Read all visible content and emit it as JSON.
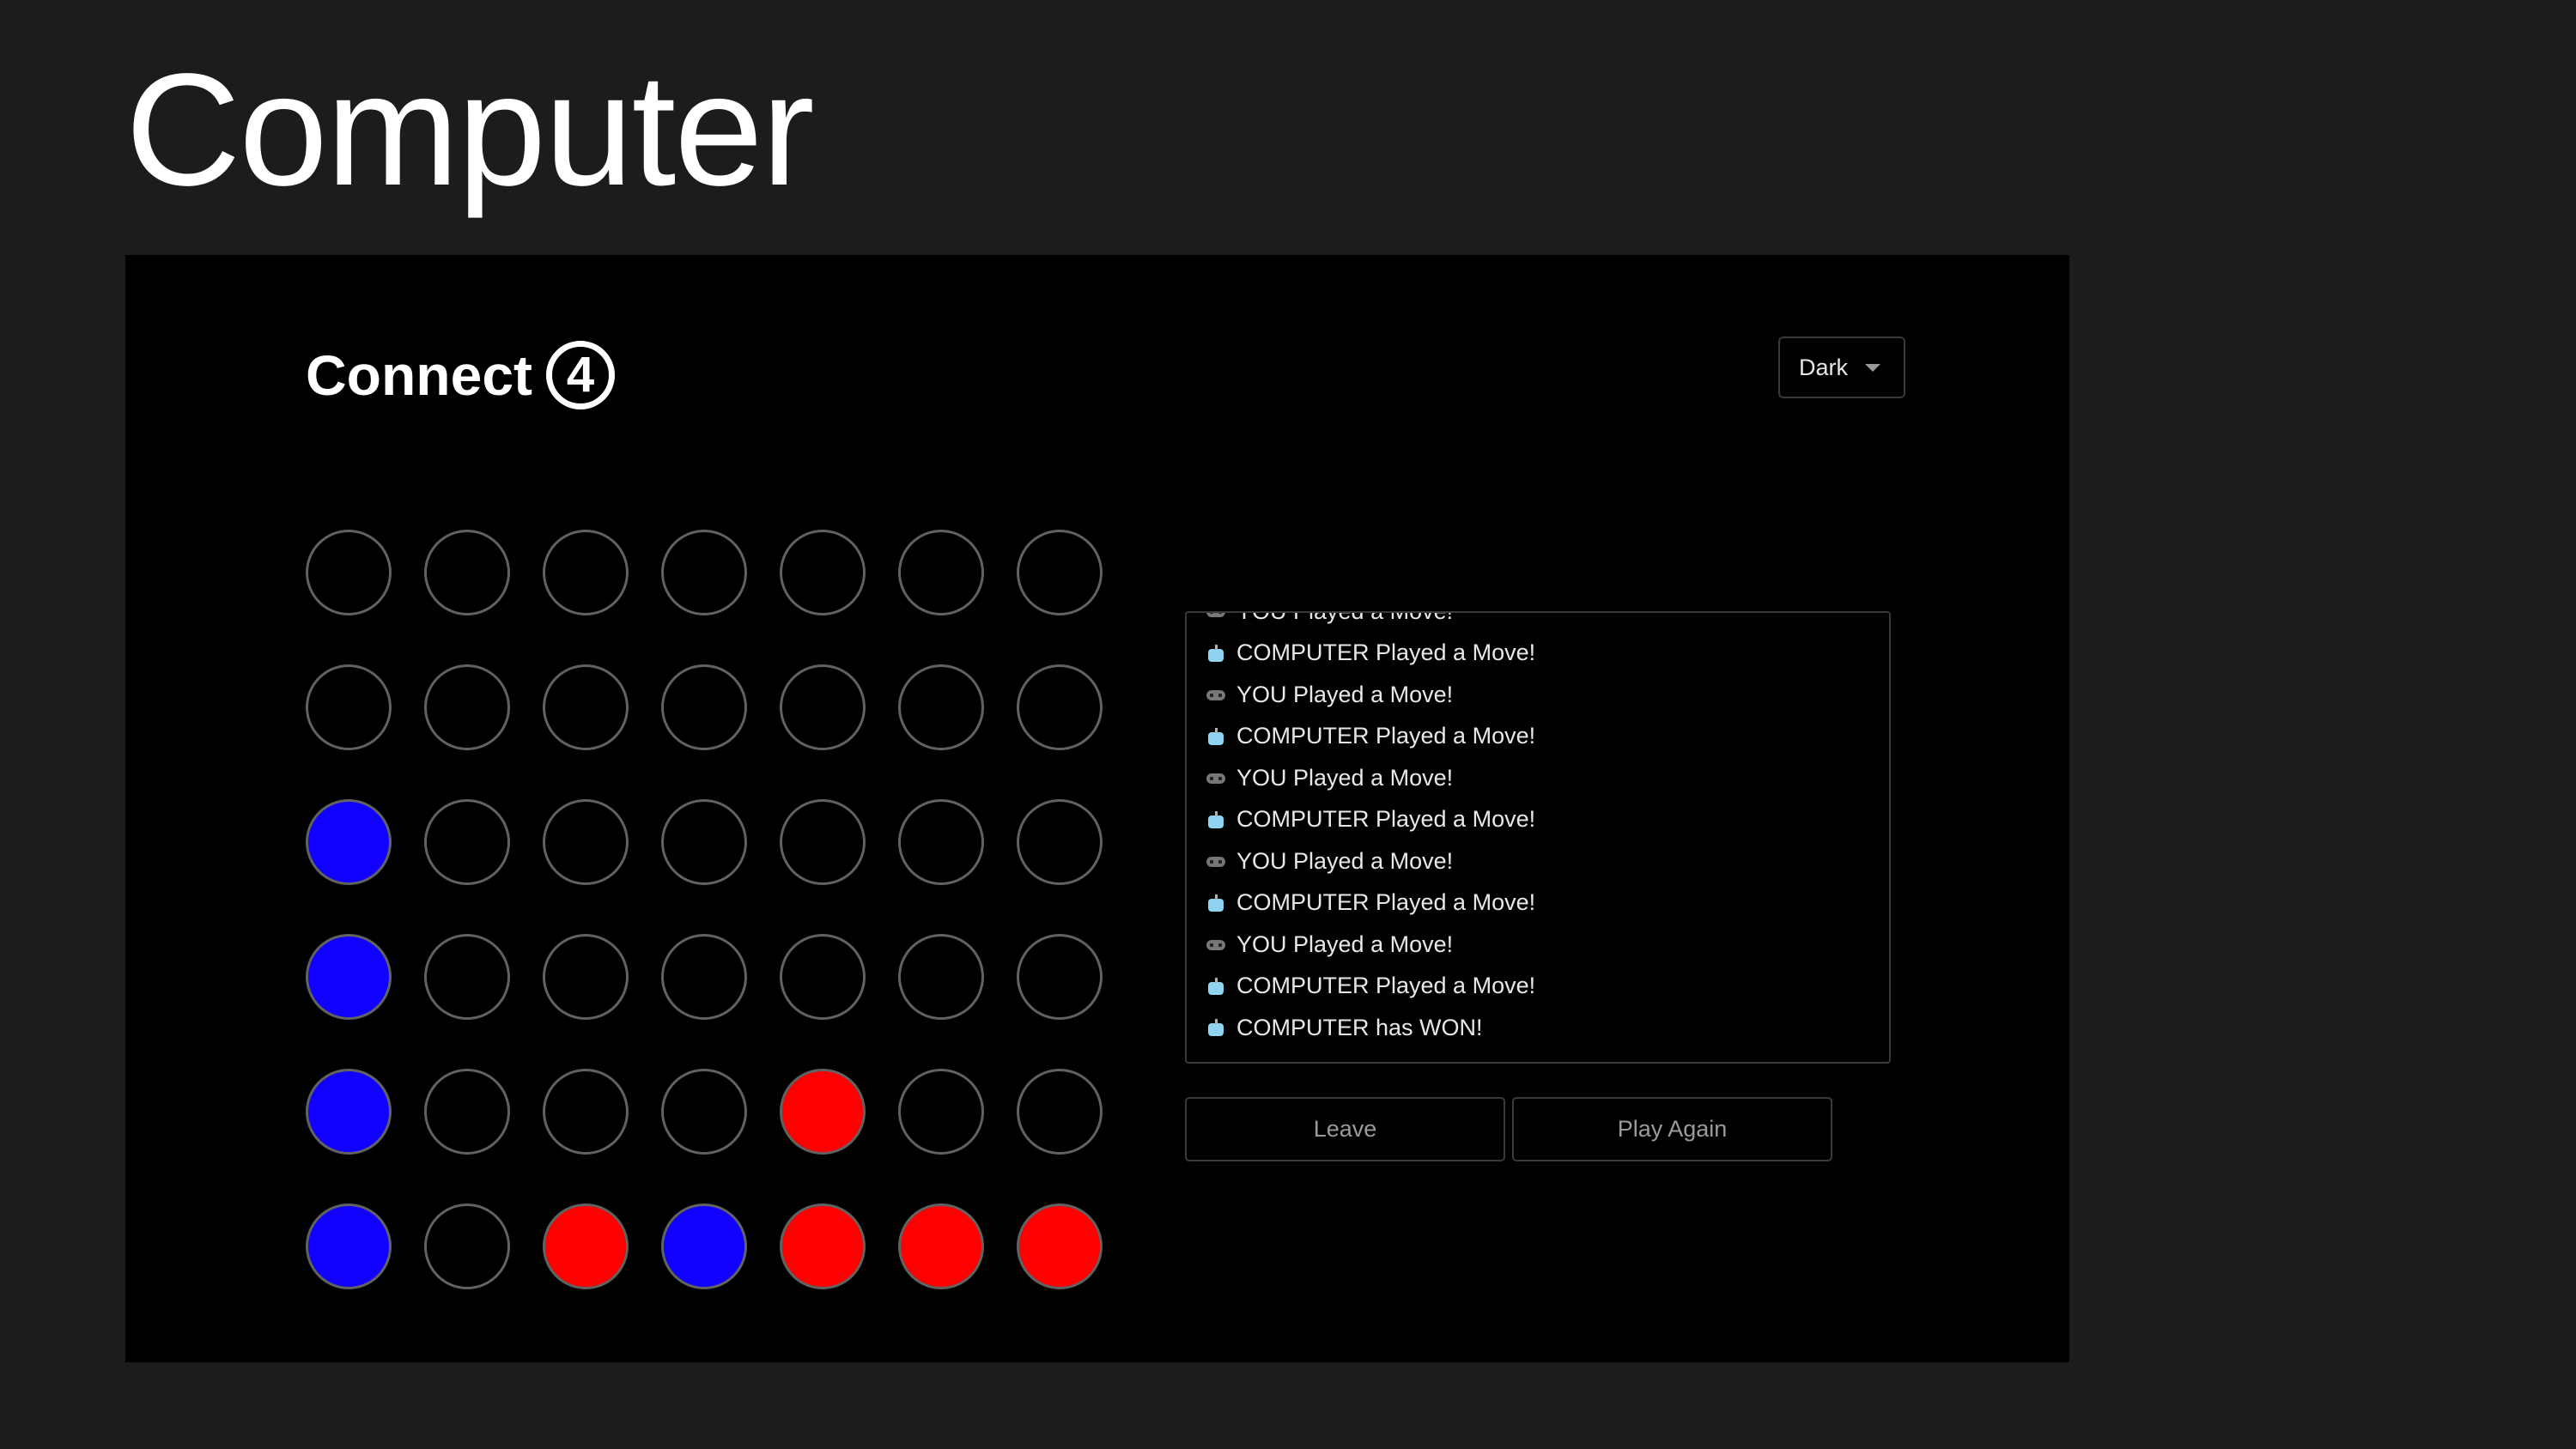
{
  "slide": {
    "title": "Computer"
  },
  "app": {
    "title": "Connect",
    "title_logo": "4",
    "theme_select": {
      "value": "Dark"
    }
  },
  "colors": {
    "background": "#1c1c1d",
    "app_background": "#000000",
    "blue_disc": "#1000ff",
    "red_disc": "#ff0000",
    "empty_border": "#616161"
  },
  "board": {
    "rows": 6,
    "columns": 7,
    "cells": [
      [
        "empty",
        "empty",
        "empty",
        "empty",
        "empty",
        "empty",
        "empty"
      ],
      [
        "empty",
        "empty",
        "empty",
        "empty",
        "empty",
        "empty",
        "empty"
      ],
      [
        "blue",
        "empty",
        "empty",
        "empty",
        "empty",
        "empty",
        "empty"
      ],
      [
        "blue",
        "empty",
        "empty",
        "empty",
        "empty",
        "empty",
        "empty"
      ],
      [
        "blue",
        "empty",
        "empty",
        "empty",
        "red",
        "empty",
        "empty"
      ],
      [
        "blue",
        "empty",
        "red",
        "blue",
        "red",
        "red",
        "red"
      ]
    ]
  },
  "log": {
    "entries": [
      {
        "icon": "gamepad-icon",
        "text": "YOU Played a Move!"
      },
      {
        "icon": "robot-icon",
        "text": "COMPUTER Played a Move!"
      },
      {
        "icon": "gamepad-icon",
        "text": "YOU Played a Move!"
      },
      {
        "icon": "robot-icon",
        "text": "COMPUTER Played a Move!"
      },
      {
        "icon": "gamepad-icon",
        "text": "YOU Played a Move!"
      },
      {
        "icon": "robot-icon",
        "text": "COMPUTER Played a Move!"
      },
      {
        "icon": "gamepad-icon",
        "text": "YOU Played a Move!"
      },
      {
        "icon": "robot-icon",
        "text": "COMPUTER Played a Move!"
      },
      {
        "icon": "gamepad-icon",
        "text": "YOU Played a Move!"
      },
      {
        "icon": "robot-icon",
        "text": "COMPUTER Played a Move!"
      },
      {
        "icon": "robot-icon",
        "text": "COMPUTER has WON!"
      }
    ]
  },
  "actions": {
    "leave_label": "Leave",
    "play_again_label": "Play Again"
  }
}
